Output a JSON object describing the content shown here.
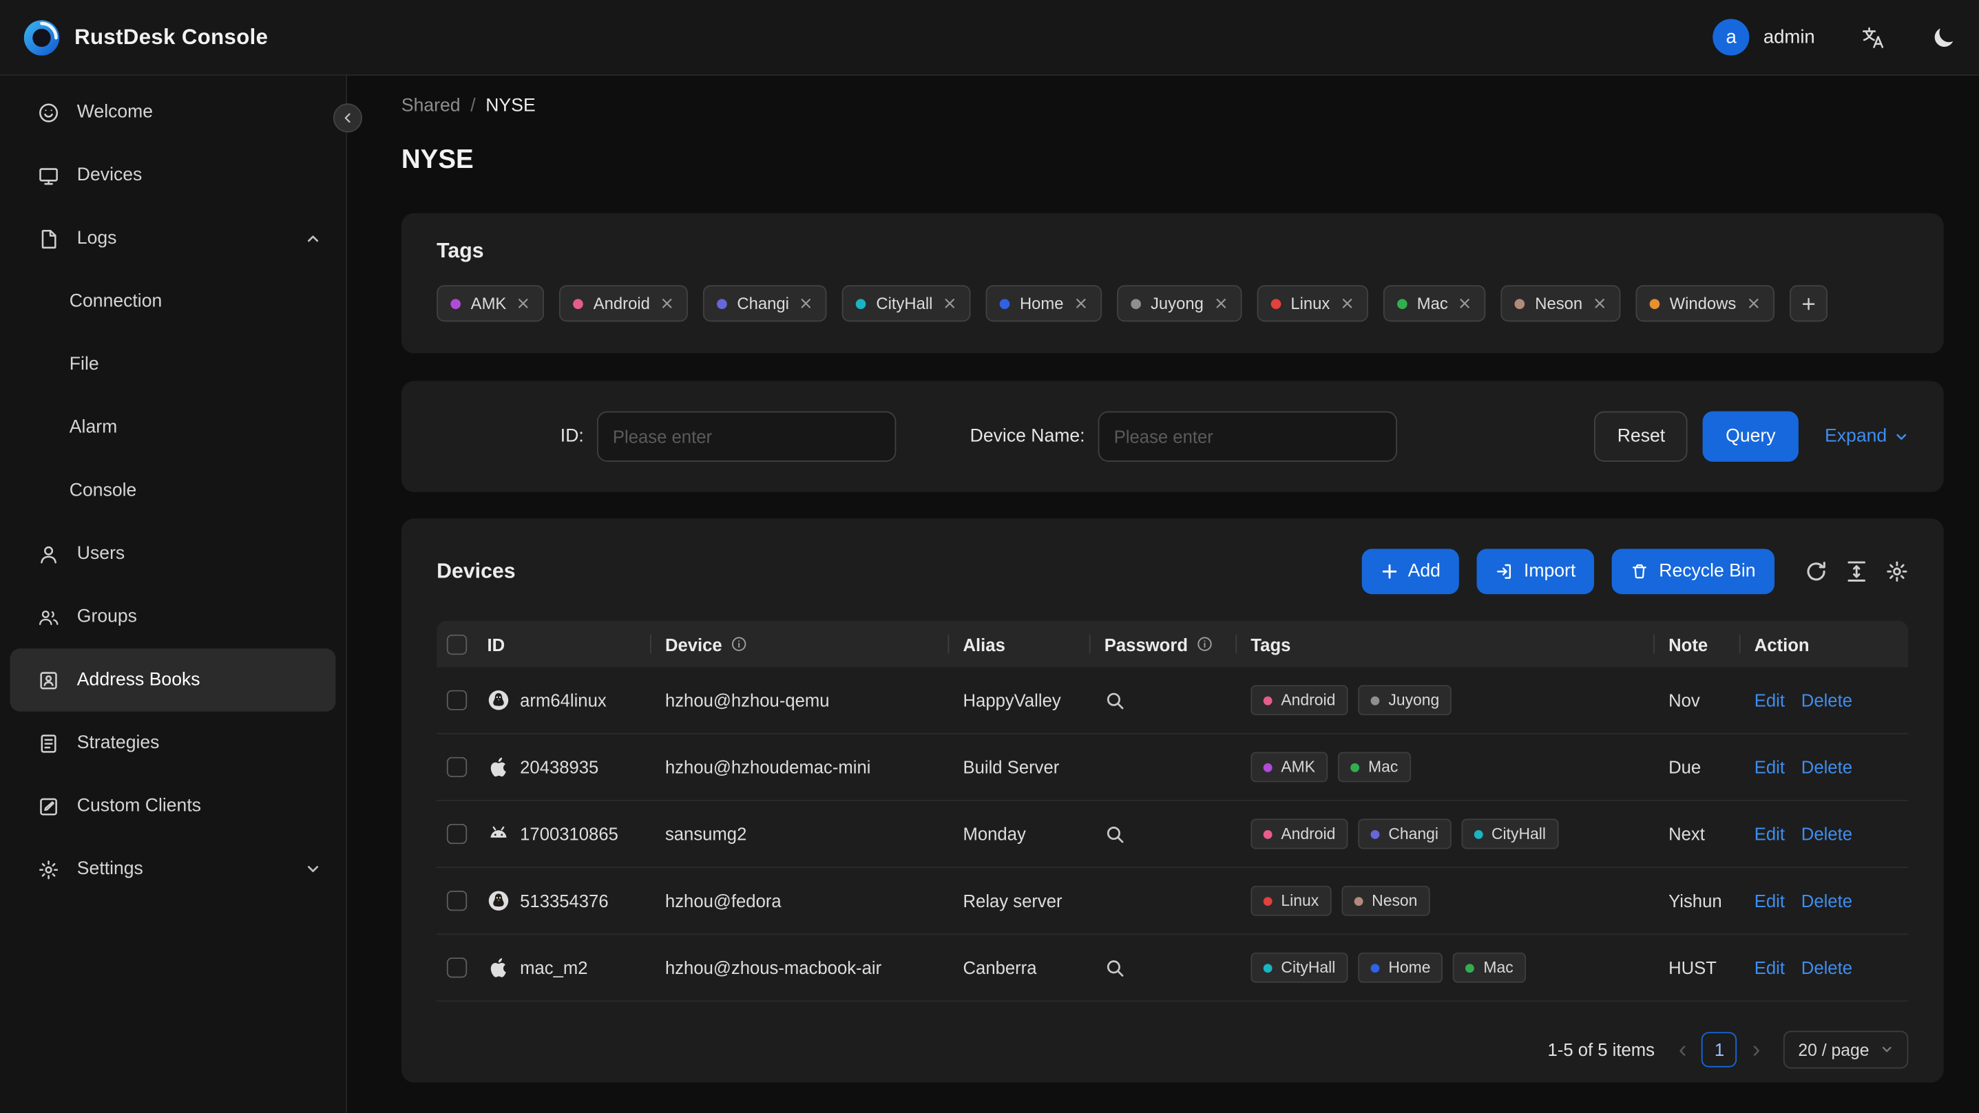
{
  "header": {
    "app_title": "RustDesk Console",
    "user": {
      "avatar_letter": "a",
      "name": "admin"
    }
  },
  "sidebar": {
    "items": [
      {
        "label": "Welcome",
        "icon": "welcome-icon"
      },
      {
        "label": "Devices",
        "icon": "devices-icon"
      },
      {
        "label": "Logs",
        "icon": "logs-icon",
        "expanded": true,
        "children": [
          {
            "label": "Connection"
          },
          {
            "label": "File"
          },
          {
            "label": "Alarm"
          },
          {
            "label": "Console"
          }
        ]
      },
      {
        "label": "Users",
        "icon": "users-icon"
      },
      {
        "label": "Groups",
        "icon": "groups-icon"
      },
      {
        "label": "Address Books",
        "icon": "address-books-icon",
        "selected": true
      },
      {
        "label": "Strategies",
        "icon": "strategies-icon"
      },
      {
        "label": "Custom Clients",
        "icon": "custom-clients-icon"
      },
      {
        "label": "Settings",
        "icon": "settings-icon",
        "collapsible": true,
        "expanded_state": false
      }
    ]
  },
  "breadcrumb": {
    "parent": "Shared",
    "separator": "/",
    "current": "NYSE"
  },
  "page_title": "NYSE",
  "tags_card": {
    "title": "Tags",
    "tags": [
      {
        "label": "AMK",
        "color": "#b04bd8"
      },
      {
        "label": "Android",
        "color": "#e75c8d"
      },
      {
        "label": "Changi",
        "color": "#6667d8"
      },
      {
        "label": "CityHall",
        "color": "#19b5c2"
      },
      {
        "label": "Home",
        "color": "#2f62e4"
      },
      {
        "label": "Juyong",
        "color": "#8f8f8f"
      },
      {
        "label": "Linux",
        "color": "#e2413c"
      },
      {
        "label": "Mac",
        "color": "#32ae50"
      },
      {
        "label": "Neson",
        "color": "#b28a7c"
      },
      {
        "label": "Windows",
        "color": "#e69030"
      }
    ]
  },
  "filter": {
    "id_label": "ID:",
    "device_name_label": "Device Name:",
    "placeholder": "Please enter",
    "reset_label": "Reset",
    "query_label": "Query",
    "expand_label": "Expand"
  },
  "devices": {
    "title": "Devices",
    "add_label": "Add",
    "import_label": "Import",
    "recycle_label": "Recycle Bin",
    "table": {
      "columns": [
        {
          "label": "ID"
        },
        {
          "label": "Device",
          "info": true
        },
        {
          "label": "Alias"
        },
        {
          "label": "Password",
          "info": true
        },
        {
          "label": "Tags"
        },
        {
          "label": "Note"
        },
        {
          "label": "Action"
        }
      ],
      "edit_label": "Edit",
      "delete_label": "Delete",
      "rows": [
        {
          "os_icon": "linux-icon",
          "id": "arm64linux",
          "device": "hzhou@hzhou-qemu",
          "alias": "HappyValley",
          "password_reveal": true,
          "tags": [
            "Android",
            "Juyong"
          ],
          "note": "Nov"
        },
        {
          "os_icon": "apple-icon",
          "id": "20438935",
          "device": "hzhou@hzhoudemac-mini",
          "alias": "Build Server",
          "password_reveal": false,
          "tags": [
            "AMK",
            "Mac"
          ],
          "note": "Due"
        },
        {
          "os_icon": "android-icon",
          "id": "1700310865",
          "device": "sansumg2",
          "alias": "Monday",
          "password_reveal": true,
          "tags": [
            "Android",
            "Changi",
            "CityHall"
          ],
          "note": "Next"
        },
        {
          "os_icon": "linux-icon",
          "id": "513354376",
          "device": "hzhou@fedora",
          "alias": "Relay server",
          "password_reveal": false,
          "tags": [
            "Linux",
            "Neson"
          ],
          "note": "Yishun"
        },
        {
          "os_icon": "apple-icon",
          "id": "mac_m2",
          "device": "hzhou@zhous-macbook-air",
          "alias": "Canberra",
          "password_reveal": true,
          "tags": [
            "CityHall",
            "Home",
            "Mac"
          ],
          "note": "HUST"
        }
      ]
    },
    "pagination": {
      "total": "1-5 of 5 items",
      "page": "1",
      "page_size": "20 / page"
    }
  }
}
